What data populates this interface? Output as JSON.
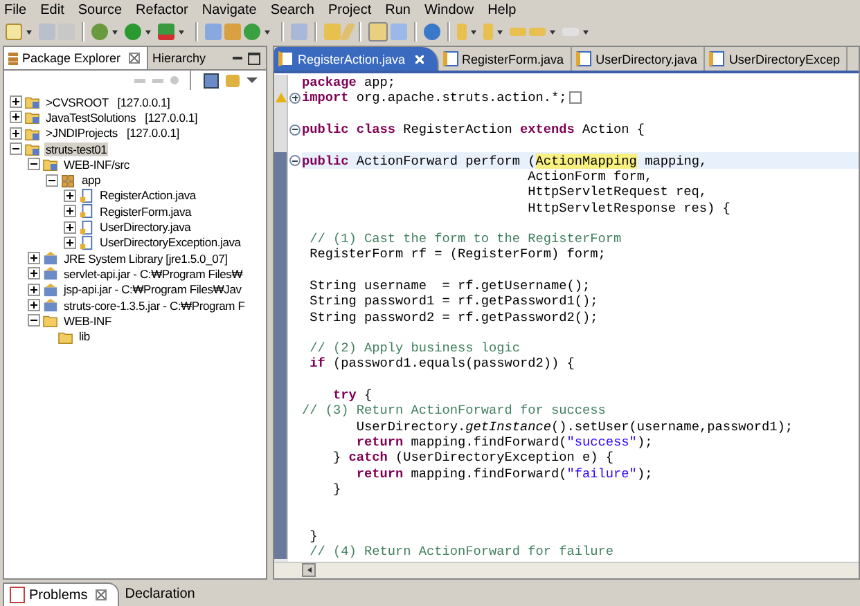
{
  "menu": [
    "File",
    "Edit",
    "Source",
    "Refactor",
    "Navigate",
    "Search",
    "Project",
    "Run",
    "Window",
    "Help"
  ],
  "left_panel": {
    "tabs": [
      {
        "label": "Package Explorer",
        "selected": true
      },
      {
        "label": "Hierarchy",
        "selected": false
      }
    ],
    "tree": [
      {
        "label": ">CVSROOT   [127.0.0.1]",
        "kind": "project",
        "expanded": false,
        "selected": false
      },
      {
        "label": "JavaTestSolutions   [127.0.0.1]",
        "kind": "project",
        "expanded": false,
        "selected": false
      },
      {
        "label": ">JNDIProjects   [127.0.0.1]",
        "kind": "project",
        "expanded": false,
        "selected": false
      },
      {
        "label": "struts-test01",
        "kind": "project",
        "expanded": true,
        "selected": true,
        "children": [
          {
            "label": "WEB-INF/src",
            "kind": "source",
            "expanded": true,
            "selected": false,
            "children": [
              {
                "label": "app",
                "kind": "package",
                "expanded": true,
                "selected": false,
                "children": [
                  {
                    "label": "RegisterAction.java",
                    "kind": "java",
                    "expanded": false,
                    "selected": false
                  },
                  {
                    "label": "RegisterForm.java",
                    "kind": "java",
                    "expanded": false,
                    "selected": false
                  },
                  {
                    "label": "UserDirectory.java",
                    "kind": "java",
                    "expanded": false,
                    "selected": false
                  },
                  {
                    "label": "UserDirectoryException.java",
                    "kind": "java",
                    "expanded": false,
                    "selected": false
                  }
                ]
              }
            ]
          },
          {
            "label": "JRE System Library [jre1.5.0_07]",
            "kind": "library",
            "expanded": false,
            "selected": false
          },
          {
            "label": "servlet-api.jar - C:₩Program Files₩",
            "kind": "jar",
            "expanded": false,
            "selected": false
          },
          {
            "label": "jsp-api.jar - C:₩Program Files₩Jav",
            "kind": "jar",
            "expanded": false,
            "selected": false
          },
          {
            "label": "struts-core-1.3.5.jar - C:₩Program F",
            "kind": "jar",
            "expanded": false,
            "selected": false
          },
          {
            "label": "WEB-INF",
            "kind": "folder",
            "expanded": true,
            "selected": false,
            "children": [
              {
                "label": "lib",
                "kind": "folder",
                "selected": false
              }
            ]
          }
        ]
      }
    ]
  },
  "editor": {
    "tabs": [
      {
        "label": "RegisterAction.java",
        "selected": true
      },
      {
        "label": "RegisterForm.java",
        "selected": false
      },
      {
        "label": "UserDirectory.java",
        "selected": false
      },
      {
        "label": "UserDirectoryExcep",
        "selected": false
      }
    ],
    "lines": [
      {
        "range": false,
        "tokens": [
          {
            "kind": "keyword",
            "text": "package"
          },
          {
            "kind": "plain",
            "text": " app;"
          }
        ]
      },
      {
        "range": false,
        "warning": true,
        "collapsed": true,
        "tokens": [
          {
            "kind": "keyword",
            "text": "import"
          },
          {
            "kind": "plain",
            "text": " org.apache.struts.action.*;"
          }
        ]
      },
      {
        "range": false
      },
      {
        "range": false,
        "collapsed": false,
        "tokens": [
          {
            "kind": "keyword",
            "text": "public class"
          },
          {
            "kind": "plain",
            "text": " RegisterAction "
          },
          {
            "kind": "keyword",
            "text": "extends"
          },
          {
            "kind": "plain",
            "text": " Action {"
          }
        ]
      },
      {
        "range": false
      },
      {
        "range": true,
        "collapsed": false,
        "current": true,
        "tokens": [
          {
            "kind": "keyword",
            "text": "public"
          },
          {
            "kind": "plain",
            "text": " ActionForward perform ("
          },
          {
            "kind": "occurrence",
            "text": "ActionMapping"
          },
          {
            "kind": "plain",
            "text": " mapping,"
          }
        ]
      },
      {
        "range": true,
        "tokens": [
          {
            "kind": "plain",
            "text": "                             ActionForm form,"
          }
        ]
      },
      {
        "range": true,
        "tokens": [
          {
            "kind": "plain",
            "text": "                             HttpServletRequest req,"
          }
        ]
      },
      {
        "range": true,
        "tokens": [
          {
            "kind": "plain",
            "text": "                             HttpServletResponse res) {"
          }
        ]
      },
      {
        "range": true
      },
      {
        "range": true,
        "tokens": [
          {
            "kind": "comment",
            "text": " // (1) Cast the form to the RegisterForm"
          }
        ]
      },
      {
        "range": true,
        "tokens": [
          {
            "kind": "plain",
            "text": " RegisterForm rf = (RegisterForm) form;"
          }
        ]
      },
      {
        "range": true
      },
      {
        "range": true,
        "tokens": [
          {
            "kind": "plain",
            "text": " String username  = rf.getUsername();"
          }
        ]
      },
      {
        "range": true,
        "tokens": [
          {
            "kind": "plain",
            "text": " String password1 = rf.getPassword1();"
          }
        ]
      },
      {
        "range": true,
        "tokens": [
          {
            "kind": "plain",
            "text": " String password2 = rf.getPassword2();"
          }
        ]
      },
      {
        "range": true
      },
      {
        "range": true,
        "tokens": [
          {
            "kind": "comment",
            "text": " // (2) Apply business logic"
          }
        ]
      },
      {
        "range": true,
        "tokens": [
          {
            "kind": "keyword",
            "text": " if"
          },
          {
            "kind": "plain",
            "text": " (password1.equals(password2)) {"
          }
        ]
      },
      {
        "range": true
      },
      {
        "range": true,
        "tokens": [
          {
            "kind": "keyword",
            "text": "    try"
          },
          {
            "kind": "plain",
            "text": " {"
          }
        ]
      },
      {
        "range": true,
        "tokens": [
          {
            "kind": "comment",
            "text": "// (3) Return ActionForward for success"
          }
        ]
      },
      {
        "range": true,
        "tokens": [
          {
            "kind": "plain",
            "text": "       UserDirectory."
          },
          {
            "kind": "static",
            "text": "getInstance"
          },
          {
            "kind": "plain",
            "text": "().setUser(username,password1);"
          }
        ]
      },
      {
        "range": true,
        "tokens": [
          {
            "kind": "keyword",
            "text": "       return"
          },
          {
            "kind": "plain",
            "text": " mapping.findForward("
          },
          {
            "kind": "string",
            "text": "\"success\""
          },
          {
            "kind": "plain",
            "text": ");"
          }
        ]
      },
      {
        "range": true,
        "tokens": [
          {
            "kind": "plain",
            "text": "    } "
          },
          {
            "kind": "keyword",
            "text": "catch"
          },
          {
            "kind": "plain",
            "text": " (UserDirectoryException e) {"
          }
        ]
      },
      {
        "range": true,
        "tokens": [
          {
            "kind": "keyword",
            "text": "       return"
          },
          {
            "kind": "plain",
            "text": " mapping.findForward("
          },
          {
            "kind": "string",
            "text": "\"failure\""
          },
          {
            "kind": "plain",
            "text": ");"
          }
        ]
      },
      {
        "range": true,
        "tokens": [
          {
            "kind": "plain",
            "text": "    }"
          }
        ]
      },
      {
        "range": true
      },
      {
        "range": true
      },
      {
        "range": true,
        "tokens": [
          {
            "kind": "plain",
            "text": " }"
          }
        ]
      },
      {
        "range": true,
        "tokens": [
          {
            "kind": "comment",
            "text": " // (4) Return ActionForward for failure"
          }
        ]
      }
    ]
  },
  "bottom_panel": {
    "tabs": [
      {
        "label": "Problems",
        "selected": true
      },
      {
        "label": "Declaration",
        "selected": false
      }
    ]
  }
}
